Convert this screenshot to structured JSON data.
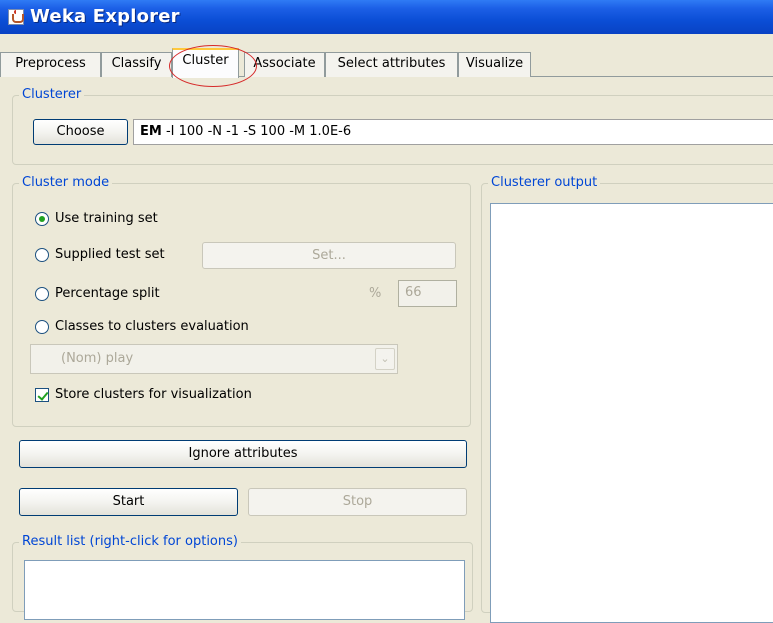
{
  "window": {
    "title": "Weka Explorer"
  },
  "tabs": [
    "Preprocess",
    "Classify",
    "Cluster",
    "Associate",
    "Select attributes",
    "Visualize"
  ],
  "active_tab": "Cluster",
  "clusterer": {
    "section_title": "Clusterer",
    "choose_label": "Choose",
    "algorithm": "EM",
    "options": "-I 100 -N -1 -S 100 -M 1.0E-6"
  },
  "cluster_mode": {
    "section_title": "Cluster mode",
    "use_training_set": "Use training set",
    "supplied_test_set": "Supplied test set",
    "set_button": "Set...",
    "percentage_split": "Percentage split",
    "percent_symbol": "%",
    "percentage_value": "66",
    "classes_to_clusters": "Classes to clusters evaluation",
    "class_select_value": "(Nom) play",
    "store_clusters": "Store clusters for visualization",
    "selected_mode": "Use training set",
    "store_clusters_checked": true
  },
  "ignore_attributes_label": "Ignore attributes",
  "start_label": "Start",
  "stop_label": "Stop",
  "result_list": {
    "section_title": "Result list (right-click for options)"
  },
  "output": {
    "section_title": "Clusterer output"
  },
  "colors": {
    "title_bar": "#0b4ed6",
    "group_title": "#0046d5",
    "highlight_circle": "#d62a2a",
    "check_green": "#21a121"
  },
  "icons": {
    "title": "java-cup-icon",
    "radio": "radio-icon",
    "checkbox": "checkbox-icon",
    "dropdown": "chevron-down-icon"
  }
}
